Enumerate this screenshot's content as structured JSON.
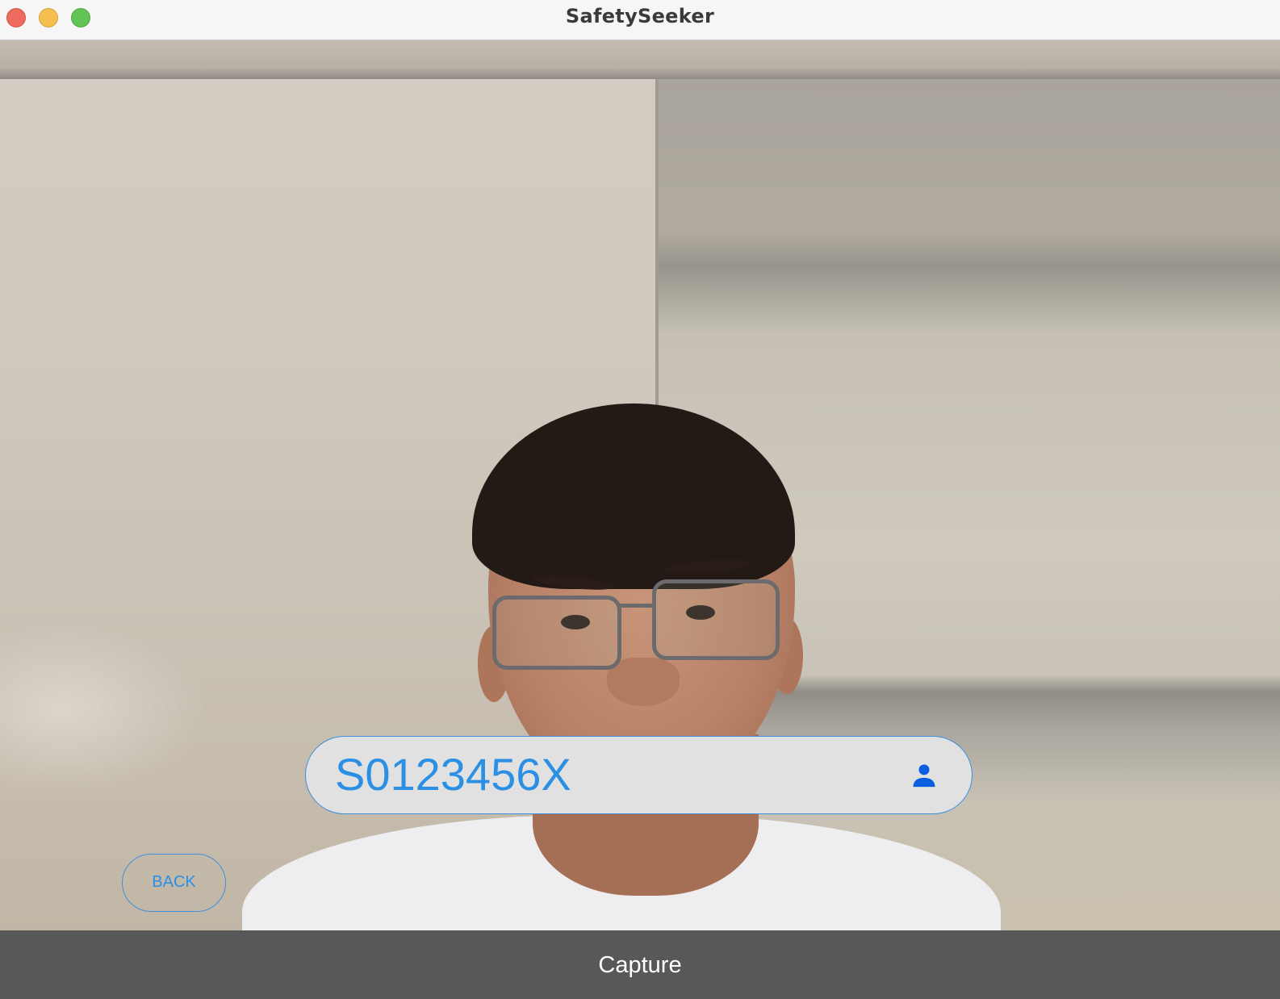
{
  "window": {
    "title": "SafetySeeker"
  },
  "form": {
    "id_value": "S0123456X",
    "id_icon": "user-icon",
    "back_label": "BACK",
    "capture_label": "Capture"
  },
  "colors": {
    "accent": "#2b8fe4",
    "field_bg": "#e1e1e1",
    "capture_bar_bg": "#585858",
    "icon": "#0a5fe0"
  }
}
